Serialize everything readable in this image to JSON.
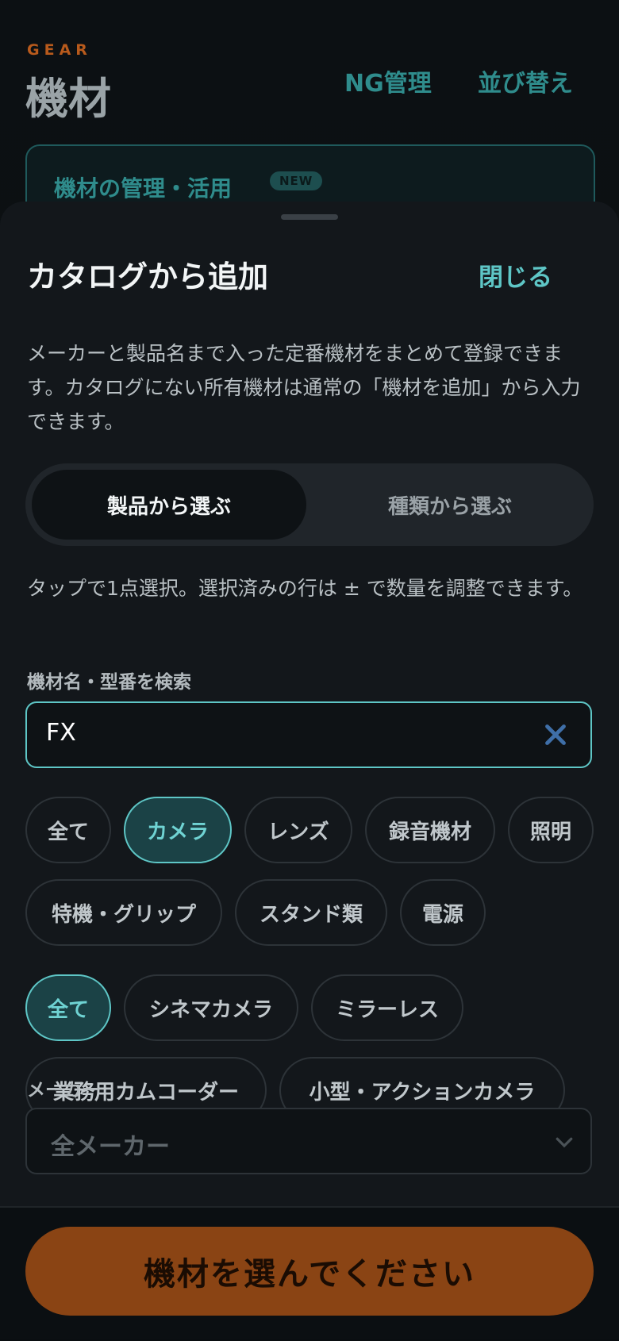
{
  "background": {
    "eyebrow": "GEAR",
    "title": "機材",
    "ng_link": "NG管理",
    "sort_link": "並び替え",
    "card_title": "機材の管理・活用",
    "card_badge": "NEW"
  },
  "sheet": {
    "title": "カタログから追加",
    "close_label": "閉じる",
    "description": "メーカーと製品名まで入った定番機材をまとめて登録できます。カタログにない所有機材は通常の「機材を追加」から入力できます。",
    "segments": [
      "製品から選ぶ",
      "種類から選ぶ"
    ],
    "hint": "タップで1点選択。選択済みの行は ± で数量を調整できます。",
    "search": {
      "label": "機材名・型番を検索",
      "value": "FX"
    },
    "categories": [
      "全て",
      "カメラ",
      "レンズ",
      "録音機材",
      "照明",
      "特機・グリップ",
      "スタンド類",
      "電源"
    ],
    "subcategories": [
      "全て",
      "シネマカメラ",
      "ミラーレス",
      "業務用カムコーダー",
      "小型・アクションカメラ"
    ],
    "maker": {
      "label": "メーカー",
      "value": "全メーカー"
    },
    "cta_label": "機材を選んでください"
  },
  "colors": {
    "accent": "#5ec6c6",
    "brand_orange": "#b85a1c",
    "cta_bg": "#8a4414"
  }
}
